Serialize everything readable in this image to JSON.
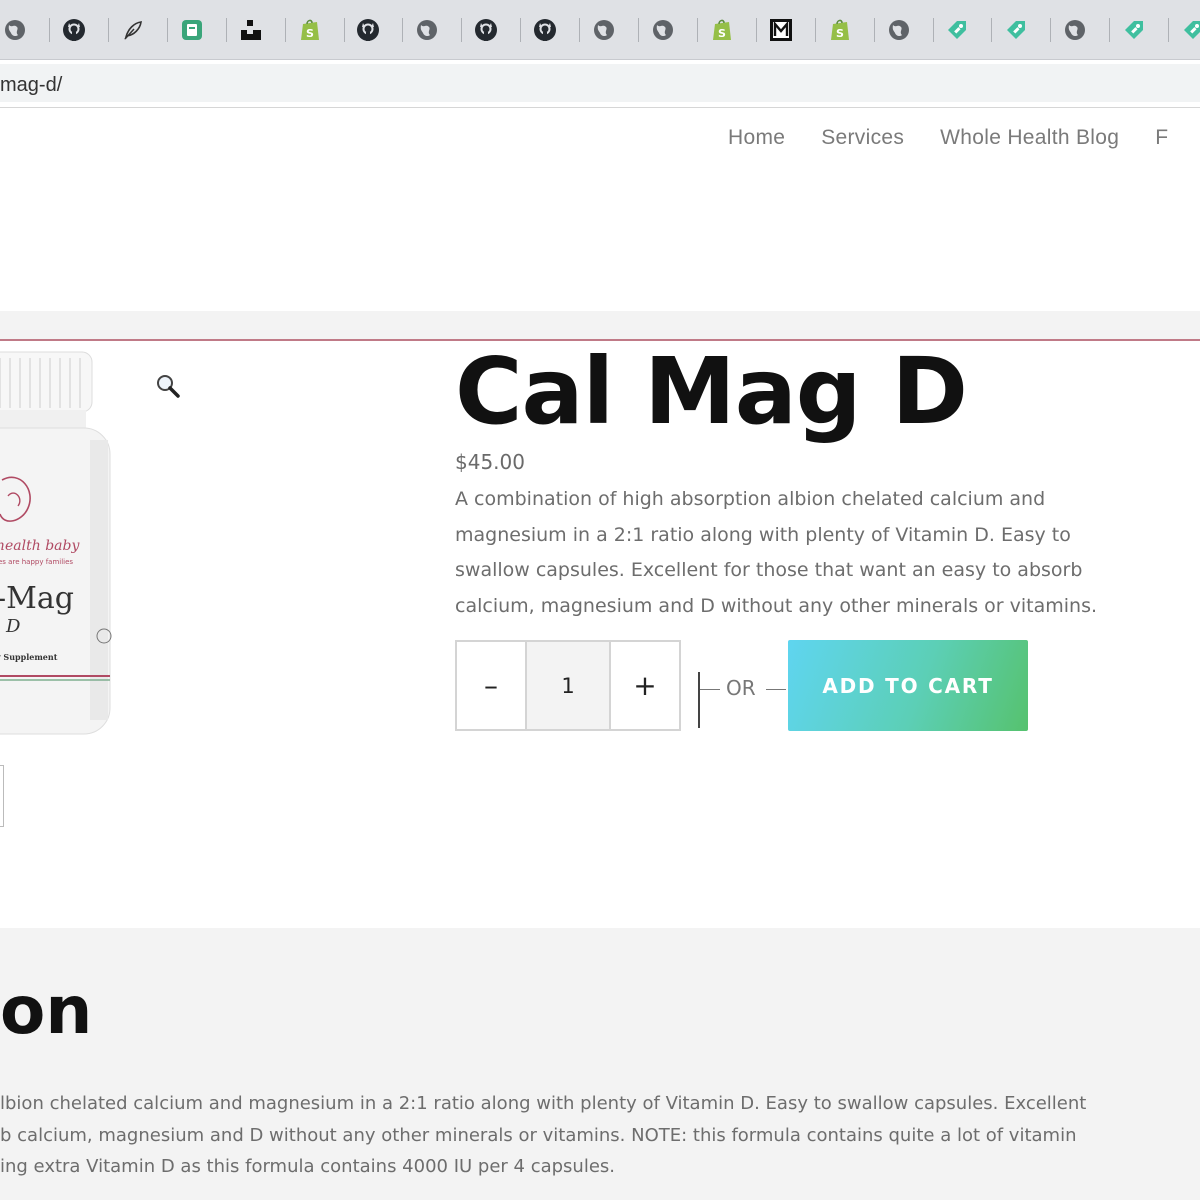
{
  "browser": {
    "tabs": [
      {
        "icon": "globe-icon"
      },
      {
        "icon": "github-icon"
      },
      {
        "icon": "feather-icon"
      },
      {
        "icon": "app-green-icon"
      },
      {
        "icon": "dark-block-icon"
      },
      {
        "icon": "shopify-icon"
      },
      {
        "icon": "github-icon"
      },
      {
        "icon": "globe-icon"
      },
      {
        "icon": "github-icon"
      },
      {
        "icon": "github-icon"
      },
      {
        "icon": "globe-icon"
      },
      {
        "icon": "globe-icon"
      },
      {
        "icon": "shopify-icon"
      },
      {
        "icon": "m-logo-icon"
      },
      {
        "icon": "shopify-icon"
      },
      {
        "icon": "globe-icon"
      },
      {
        "icon": "tag-icon"
      },
      {
        "icon": "tag-icon"
      },
      {
        "icon": "globe-icon"
      },
      {
        "icon": "tag-icon"
      },
      {
        "icon": "tag-icon"
      }
    ],
    "url": "mag-d/"
  },
  "nav": {
    "items": [
      "Home",
      "Services",
      "Whole Health Blog",
      "F"
    ]
  },
  "product": {
    "title": "Cal Mag D",
    "price": "$45.00",
    "description_lines": [
      "A combination of high absorption albion chelated calcium and",
      "magnesium in a 2:1 ratio along with plenty of Vitamin D. Easy to",
      "swallow capsules. Excellent for those that want an easy to absorb",
      "calcium, magnesium and D without any other minerals or vitamins."
    ],
    "label": {
      "brand": "health baby",
      "tagline": "es are happy families",
      "name": "-Mag",
      "sub": "D",
      "type": "y Supplement"
    }
  },
  "cart": {
    "minus_label": "–",
    "quantity": "1",
    "plus_label": "+",
    "or_label": "OR",
    "add_to_cart_label": "ADD TO CART"
  },
  "description_section": {
    "heading": "on",
    "lines": [
      "lbion chelated calcium and magnesium in a 2:1 ratio along with plenty of Vitamin D. Easy to swallow capsules. Excellent",
      "b calcium, magnesium and D without any other minerals or vitamins. NOTE: this formula contains quite a lot of vitamin",
      "ing extra Vitamin D as this formula contains 4000 IU per 4 capsules."
    ]
  },
  "colors": {
    "accent_line": "#c07a87",
    "button_start": "#5fd5f0",
    "button_end": "#56c26e"
  }
}
